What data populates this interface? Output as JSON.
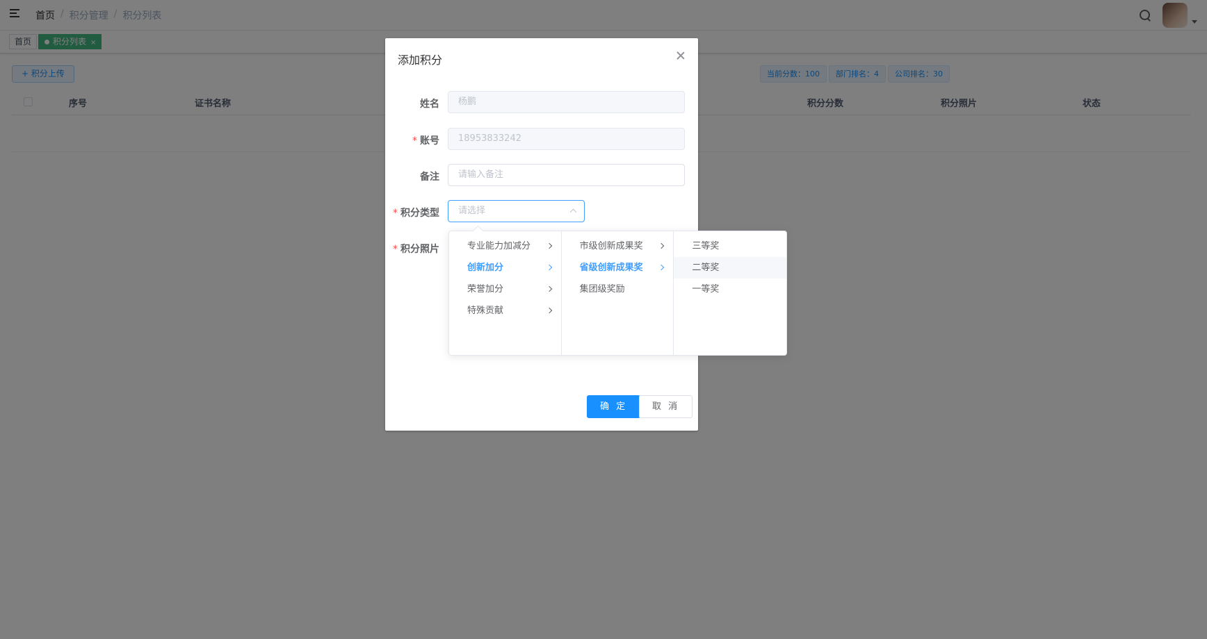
{
  "navbar": {
    "breadcrumb": [
      "首页",
      "积分管理",
      "积分列表"
    ],
    "separator": "/"
  },
  "tags": {
    "home": "首页",
    "active": "积分列表",
    "close": "×"
  },
  "toolbar": {
    "upload_label": "+ 积分上传",
    "stats": [
      "当前分数：100",
      "部门排名：4",
      "公司排名：30"
    ]
  },
  "table": {
    "columns": [
      "序号",
      "证书名称",
      "积分分数",
      "积分照片",
      "状态"
    ]
  },
  "dialog": {
    "title": "添加积分",
    "fields": {
      "name_label": "姓名",
      "name_value": "杨鹏",
      "account_label": "账号",
      "account_value": "18953833242",
      "remark_label": "备注",
      "remark_placeholder": "请输入备注",
      "type_label": "积分类型",
      "type_placeholder": "请选择",
      "photo_label": "积分照片"
    },
    "required_mark": "*",
    "confirm_label": "确 定",
    "cancel_label": "取 消"
  },
  "cascader": {
    "level1": [
      "专业能力加减分",
      "创新加分",
      "荣誉加分",
      "特殊贡献"
    ],
    "level2": [
      "市级创新成果奖",
      "省级创新成果奖",
      "集团级奖励"
    ],
    "level3": [
      "三等奖",
      "二等奖",
      "一等奖"
    ]
  },
  "colors": {
    "primary": "#1890ff",
    "tag_active": "#42b983",
    "required": "#ff4949",
    "cascader_active": "#409eff"
  }
}
